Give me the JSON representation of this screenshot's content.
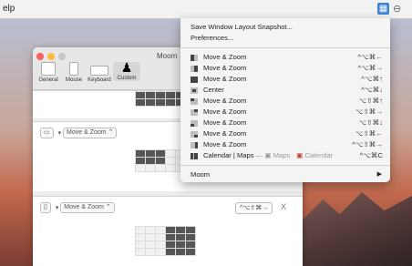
{
  "menubar": {
    "app_menu": "elp",
    "moom_icon": "moom-status-icon",
    "extra_icon": "⊖"
  },
  "prefs": {
    "window_title": "Moom",
    "toolbar": [
      {
        "label": "General",
        "icon": "general-icon"
      },
      {
        "label": "Mouse",
        "icon": "mouse-icon"
      },
      {
        "label": "Keyboard",
        "icon": "keyboard-icon"
      },
      {
        "label": "Custom",
        "icon": "person-icon"
      }
    ],
    "actions": [
      {
        "arrow": "▾",
        "type": "Move & Zoom",
        "stepper": "⌃"
      },
      {
        "arrow": "▾",
        "type": "Move & Zoom",
        "stepper": "⌃",
        "shortcut": "^⌥⇧⌘→",
        "clear": "X"
      }
    ]
  },
  "menu": {
    "top_items": [
      "Save Window Layout Snapshot...",
      "Preferences..."
    ],
    "items": [
      {
        "label": "Move & Zoom",
        "shortcut": "^⌥⌘←"
      },
      {
        "label": "Move & Zoom",
        "shortcut": "^⌥⌘→"
      },
      {
        "label": "Move & Zoom",
        "shortcut": "^⌥⌘↑"
      },
      {
        "label": "Center",
        "shortcut": "^⌥⌘↓"
      },
      {
        "label": "Move & Zoom",
        "shortcut": "⌥⇧⌘↑"
      },
      {
        "label": "Move & Zoom",
        "shortcut": "⌥⇧⌘→"
      },
      {
        "label": "Move & Zoom",
        "shortcut": "⌥⇧⌘↓"
      },
      {
        "label": "Move & Zoom",
        "shortcut": "⌥⇧⌘←"
      },
      {
        "label": "Move & Zoom",
        "shortcut": "^⌥⇧⌘→"
      }
    ],
    "snapshot": {
      "label": "Calendar | Maps",
      "dash": "—",
      "sub1": "Maps",
      "dot": "·",
      "sub2": "Calendar",
      "shortcut": "^⌥⌘C"
    },
    "moom_submenu": "Moom",
    "submenu_arrow": "▶"
  }
}
